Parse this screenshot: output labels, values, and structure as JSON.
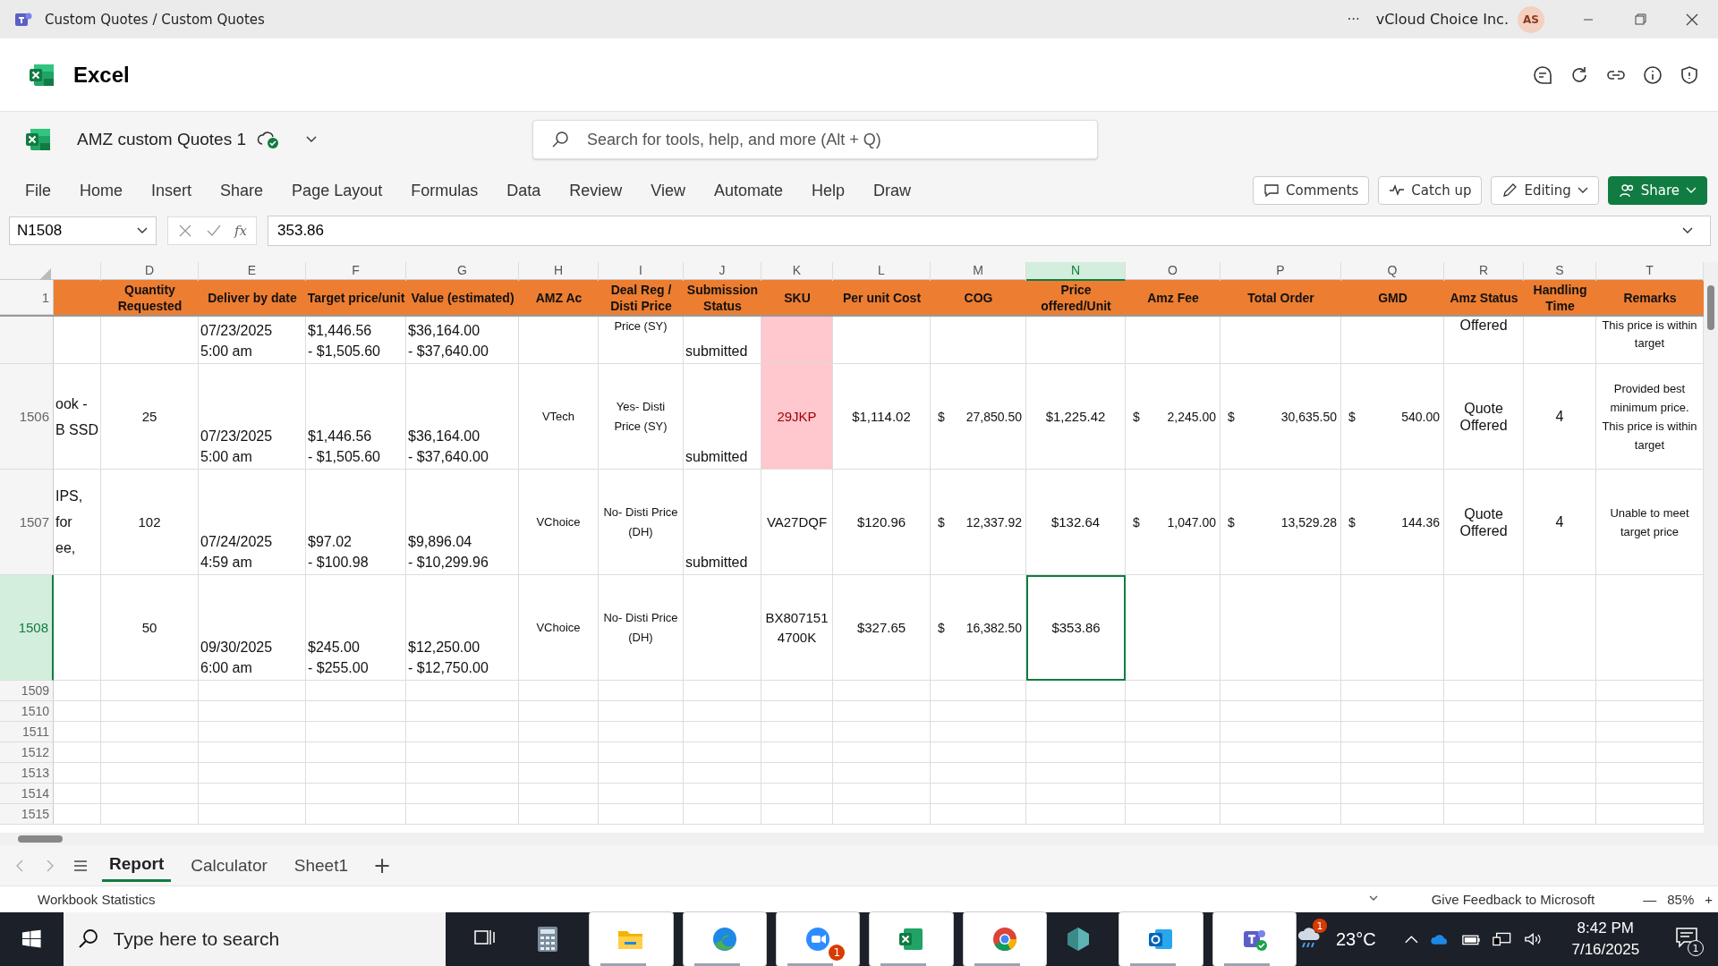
{
  "window": {
    "title": "Custom Quotes / Custom Quotes",
    "more": "···",
    "org": "vCloud Choice Inc.",
    "avatar": "AS"
  },
  "app": {
    "name": "Excel"
  },
  "document": {
    "name": "AMZ custom Quotes 1",
    "search_placeholder": "Search for tools, help, and more (Alt + Q)"
  },
  "menu": [
    "File",
    "Home",
    "Insert",
    "Share",
    "Page Layout",
    "Formulas",
    "Data",
    "Review",
    "View",
    "Automate",
    "Help",
    "Draw"
  ],
  "actions": [
    {
      "label": "Comments",
      "kind": "comments"
    },
    {
      "label": "Catch up",
      "kind": "catchup"
    },
    {
      "label": "Editing",
      "kind": "editing"
    },
    {
      "label": "Share",
      "kind": "share"
    }
  ],
  "formula_bar": {
    "name_box": "N1508",
    "fx": "fx",
    "value": "353.86"
  },
  "columns": [
    {
      "kind": "left"
    },
    {
      "letter": "D",
      "heading": "Quantity Requested",
      "kind": "center",
      "selected": false
    },
    {
      "letter": "E",
      "heading": "Deliver by date",
      "kind": "bottom",
      "selected": false
    },
    {
      "letter": "F",
      "heading": "Target price/unit",
      "kind": "bottom",
      "selected": false
    },
    {
      "letter": "G",
      "heading": "Value (estimated)",
      "kind": "bottom",
      "selected": false
    },
    {
      "letter": "H",
      "heading": "AMZ Ac",
      "kind": "small",
      "selected": false
    },
    {
      "letter": "I",
      "heading": "Deal Reg / Disti Price",
      "kind": "small",
      "selected": false
    },
    {
      "letter": "J",
      "heading": "Submission Status",
      "kind": "bottom",
      "selected": false
    },
    {
      "letter": "K",
      "heading": "SKU",
      "kind": "center",
      "selected": false
    },
    {
      "letter": "L",
      "heading": "Per unit Cost",
      "kind": "center",
      "selected": false
    },
    {
      "letter": "M",
      "heading": "COG",
      "kind": "accounting",
      "selected": false
    },
    {
      "letter": "N",
      "heading": "Price offered/Unit",
      "kind": "center",
      "selected": true
    },
    {
      "letter": "O",
      "heading": "Amz Fee",
      "kind": "accounting",
      "selected": false
    },
    {
      "letter": "P",
      "heading": "Total Order",
      "kind": "accounting",
      "selected": false
    },
    {
      "letter": "Q",
      "heading": "GMD",
      "kind": "accounting",
      "selected": false
    },
    {
      "letter": "R",
      "heading": "Amz Status",
      "kind": "wide",
      "selected": false
    },
    {
      "letter": "S",
      "heading": "Handling Time",
      "kind": "wide",
      "selected": false
    },
    {
      "letter": "T",
      "heading": "Remarks",
      "kind": "remarks",
      "selected": false
    }
  ],
  "header_row": "1",
  "rows": [
    {
      "kind": "partial",
      "selected": false,
      "cells": [
        null,
        null,
        "07/23/2025\n5:00 am",
        "$1,446.56\n- $1,505.60",
        "$36,164.00\n- $37,640.00",
        null,
        "Price (SY)",
        "submitted",
        {
          "highlighted": true
        },
        null,
        null,
        null,
        null,
        null,
        null,
        "Offered",
        null,
        "This price is within\ntarget"
      ]
    },
    {
      "kind": "full",
      "number": "1506",
      "selected": false,
      "cells": [
        "ook -\nB SSD",
        "25",
        "07/23/2025\n5:00 am",
        "$1,446.56\n- $1,505.60",
        "$36,164.00\n- $37,640.00",
        "VTech",
        "Yes- Disti\nPrice (SY)",
        "submitted",
        {
          "text": "29JKP",
          "highlighted": true
        },
        "$1,114.02",
        {
          "symbol": "$",
          "amount": "27,850.50"
        },
        "$1,225.42",
        {
          "symbol": "$",
          "amount": "2,245.00"
        },
        {
          "symbol": "$",
          "amount": "30,635.50"
        },
        {
          "symbol": "$",
          "amount": "540.00"
        },
        "Quote\nOffered",
        "4",
        "Provided best\nminimum price.\nThis price is within\ntarget"
      ]
    },
    {
      "kind": "full",
      "number": "1507",
      "selected": false,
      "cells": [
        "IPS,\nfor\nee,",
        "102",
        "07/24/2025\n4:59 am",
        "$97.02\n- $100.98",
        "$9,896.04\n- $10,299.96",
        "VChoice",
        "No- Disti Price\n(DH)",
        "submitted",
        "VA27DQF",
        "$120.96",
        {
          "symbol": "$",
          "amount": "12,337.92"
        },
        "$132.64",
        {
          "symbol": "$",
          "amount": "1,047.00"
        },
        {
          "symbol": "$",
          "amount": "13,529.28"
        },
        {
          "symbol": "$",
          "amount": "144.36"
        },
        "Quote\nOffered",
        "4",
        "Unable to meet\ntarget price"
      ]
    },
    {
      "kind": "full",
      "number": "1508",
      "selected": true,
      "cells": [
        null,
        "50",
        "09/30/2025\n6:00 am",
        "$245.00\n- $255.00",
        "$12,250.00\n- $12,750.00",
        "VChoice",
        "No- Disti Price\n(DH)",
        null,
        "BX807151\n4700K",
        "$327.65",
        {
          "symbol": "$",
          "amount": "16,382.50"
        },
        "$353.86",
        null,
        null,
        null,
        null,
        null,
        null
      ]
    },
    {
      "kind": "empty",
      "number": "1509",
      "selected": false
    },
    {
      "kind": "empty",
      "number": "1510",
      "selected": false
    },
    {
      "kind": "empty",
      "number": "1511",
      "selected": false
    },
    {
      "kind": "empty",
      "number": "1512",
      "selected": false
    },
    {
      "kind": "empty",
      "number": "1513",
      "selected": false
    },
    {
      "kind": "empty",
      "number": "1514",
      "selected": false
    },
    {
      "kind": "empty",
      "number": "1515",
      "selected": false
    }
  ],
  "sheet_tabs": [
    {
      "label": "Report",
      "selected": true
    },
    {
      "label": "Calculator",
      "selected": false
    },
    {
      "label": "Sheet1",
      "selected": false
    }
  ],
  "add_sheet": "+",
  "status_bar": {
    "left": "Workbook Statistics",
    "feedback": "Give Feedback to Microsoft",
    "zoom_out": "—",
    "zoom": "85%",
    "zoom_in": "+"
  },
  "taskbar": {
    "search_placeholder": "Type here to search",
    "apps": [
      {
        "kind": "taskview",
        "active": false
      },
      {
        "kind": "calculator",
        "active": false
      },
      {
        "kind": "folder",
        "active": true
      },
      {
        "kind": "edge",
        "active": true
      },
      {
        "kind": "zoom",
        "active": true,
        "badge": "1"
      },
      {
        "kind": "excel",
        "active": true
      },
      {
        "kind": "chrome",
        "active": true
      },
      {
        "kind": "gem",
        "active": false
      },
      {
        "kind": "outlook",
        "active": true
      },
      {
        "kind": "teams",
        "active": true
      }
    ],
    "weather_badge": "1",
    "temperature": "23°C",
    "time": "8:42 PM",
    "date": "7/16/2025",
    "notification_badge": "1"
  }
}
